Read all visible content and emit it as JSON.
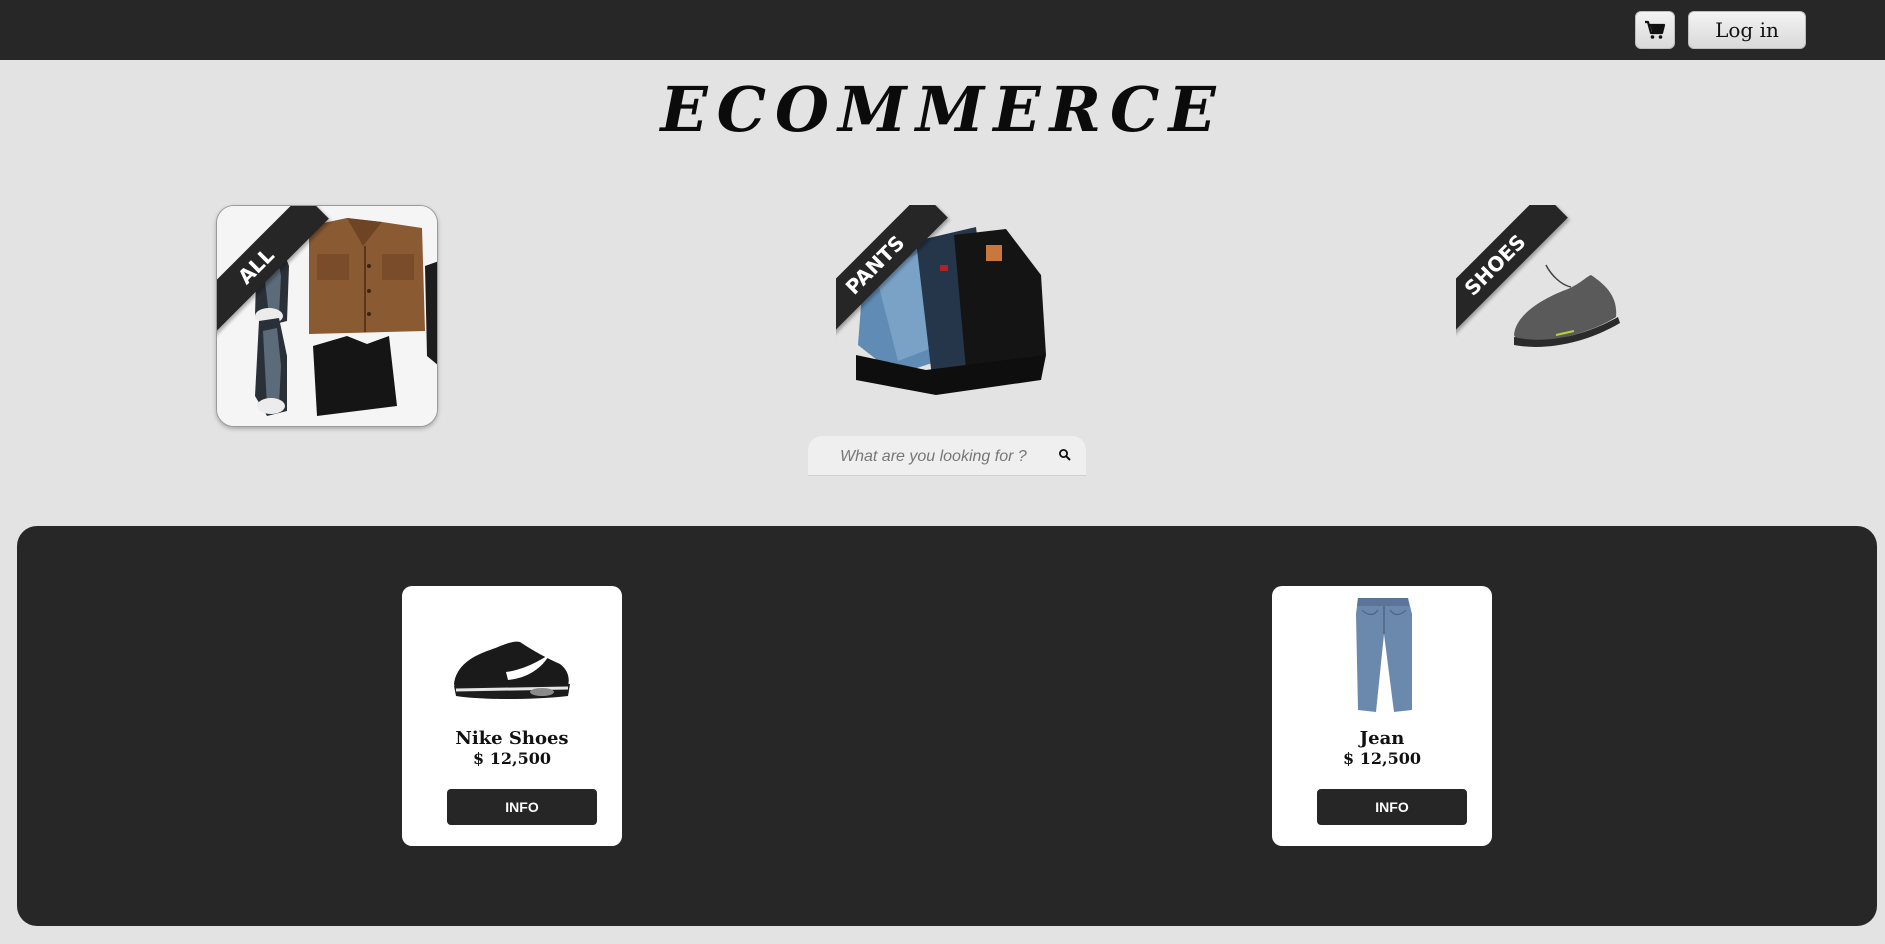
{
  "header": {
    "cart_icon": "shopping-cart-icon",
    "login_label": "Log in"
  },
  "brand": {
    "title": "ECOMMERCE"
  },
  "categories": [
    {
      "label": "ALL"
    },
    {
      "label": "PANTS"
    },
    {
      "label": "SHOES"
    }
  ],
  "search": {
    "placeholder": "What are you looking for ?",
    "icon": "search-icon"
  },
  "products": [
    {
      "name": "Nike Shoes",
      "price": "$ 12,500",
      "button_label": "INFO"
    },
    {
      "name": "Jean",
      "price": "$ 12,500",
      "button_label": "INFO"
    }
  ],
  "colors": {
    "dark": "#272727",
    "background": "#e3e3e3",
    "card": "#ffffff"
  }
}
